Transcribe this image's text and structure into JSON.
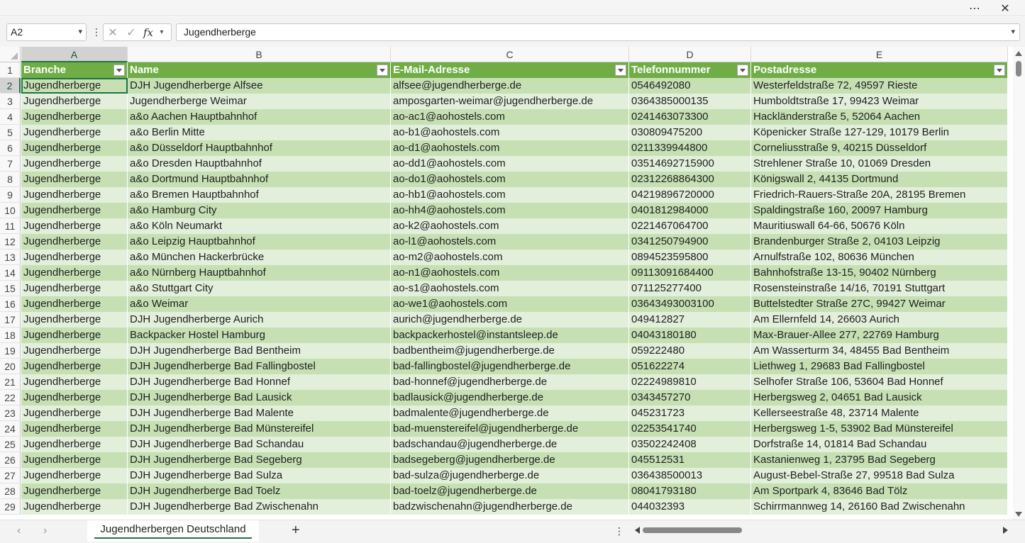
{
  "titlebar": {
    "more_icon": "ellipsis-icon",
    "close_icon": "close-icon"
  },
  "formula_bar": {
    "name_box": "A2",
    "formula_value": "Jugendherberge",
    "fx_label": "fx"
  },
  "columns": [
    {
      "letter": "A"
    },
    {
      "letter": "B"
    },
    {
      "letter": "C"
    },
    {
      "letter": "D"
    },
    {
      "letter": "E"
    }
  ],
  "header_row": {
    "number": "1",
    "cells": [
      "Branche",
      "Name",
      "E-Mail-Adresse",
      "Telefonnummer",
      "Postadresse"
    ]
  },
  "rows": [
    {
      "n": "2",
      "cells": [
        "Jugendherberge",
        "DJH Jugendherberge Alfsee",
        "alfsee@jugendherberge.de",
        "0546492080",
        "Westerfeldstraße 72, 49597 Rieste"
      ]
    },
    {
      "n": "3",
      "cells": [
        "Jugendherberge",
        "Jugendherberge Weimar",
        "amposgarten-weimar@jugendherberge.de",
        "0364385000135",
        "Humboldtstraße 17, 99423 Weimar"
      ]
    },
    {
      "n": "4",
      "cells": [
        "Jugendherberge",
        "a&o Aachen Hauptbahnhof",
        "ao-ac1@aohostels.com",
        "0241463073300",
        "Hackländerstraße 5, 52064 Aachen"
      ]
    },
    {
      "n": "5",
      "cells": [
        "Jugendherberge",
        "a&o Berlin Mitte",
        "ao-b1@aohostels.com",
        "030809475200",
        "Köpenicker Straße 127-129, 10179 Berlin"
      ]
    },
    {
      "n": "6",
      "cells": [
        "Jugendherberge",
        "a&o Düsseldorf Hauptbahnhof",
        "ao-d1@aohostels.com",
        "0211339944800",
        "Corneliusstraße 9, 40215 Düsseldorf"
      ]
    },
    {
      "n": "7",
      "cells": [
        "Jugendherberge",
        "a&o Dresden Hauptbahnhof",
        "ao-dd1@aohostels.com",
        "03514692715900",
        "Strehlener Straße 10, 01069 Dresden"
      ]
    },
    {
      "n": "8",
      "cells": [
        "Jugendherberge",
        "a&o Dortmund Hauptbahnhof",
        "ao-do1@aohostels.com",
        "02312268864300",
        "Königswall 2, 44135 Dortmund"
      ]
    },
    {
      "n": "9",
      "cells": [
        "Jugendherberge",
        "a&o Bremen Hauptbahnhof",
        "ao-hb1@aohostels.com",
        "04219896720000",
        "Friedrich-Rauers-Straße 20A, 28195 Bremen"
      ]
    },
    {
      "n": "10",
      "cells": [
        "Jugendherberge",
        "a&o Hamburg City",
        "ao-hh4@aohostels.com",
        "0401812984000",
        "Spaldingstraße 160, 20097 Hamburg"
      ]
    },
    {
      "n": "11",
      "cells": [
        "Jugendherberge",
        "a&o Köln Neumarkt",
        "ao-k2@aohostels.com",
        "0221467064700",
        "Mauritiuswall 64-66, 50676 Köln"
      ]
    },
    {
      "n": "12",
      "cells": [
        "Jugendherberge",
        "a&o Leipzig Hauptbahnhof",
        "ao-l1@aohostels.com",
        "0341250794900",
        "Brandenburger Straße 2, 04103 Leipzig"
      ]
    },
    {
      "n": "13",
      "cells": [
        "Jugendherberge",
        "a&o München Hackerbrücke",
        "ao-m2@aohostels.com",
        "0894523595800",
        "Arnulfstraße 102, 80636 München"
      ]
    },
    {
      "n": "14",
      "cells": [
        "Jugendherberge",
        "a&o Nürnberg Hauptbahnhof",
        "ao-n1@aohostels.com",
        "09113091684400",
        "Bahnhofstraße 13-15, 90402 Nürnberg"
      ]
    },
    {
      "n": "15",
      "cells": [
        "Jugendherberge",
        "a&o Stuttgart City",
        "ao-s1@aohostels.com",
        "071125277400",
        "Rosensteinstraße 14/16, 70191 Stuttgart"
      ]
    },
    {
      "n": "16",
      "cells": [
        "Jugendherberge",
        "a&o Weimar",
        "ao-we1@aohostels.com",
        "03643493003100",
        "Buttelstedter Straße 27C, 99427 Weimar"
      ]
    },
    {
      "n": "17",
      "cells": [
        "Jugendherberge",
        "DJH Jugendherberge Aurich",
        "aurich@jugendherberge.de",
        "049412827",
        "Am Ellernfeld 14, 26603 Aurich"
      ]
    },
    {
      "n": "18",
      "cells": [
        "Jugendherberge",
        "Backpacker Hostel Hamburg",
        "backpackerhostel@instantsleep.de",
        "04043180180",
        "Max-Brauer-Allee 277, 22769 Hamburg"
      ]
    },
    {
      "n": "19",
      "cells": [
        "Jugendherberge",
        "DJH Jugendherberge Bad Bentheim",
        "badbentheim@jugendherberge.de",
        "059222480",
        "Am Wasserturm 34, 48455 Bad Bentheim"
      ]
    },
    {
      "n": "20",
      "cells": [
        "Jugendherberge",
        "DJH Jugendherberge Bad Fallingbostel",
        "bad-fallingbostel@jugendherberge.de",
        "051622274",
        "Liethweg 1, 29683 Bad Fallingbostel"
      ]
    },
    {
      "n": "21",
      "cells": [
        "Jugendherberge",
        "DJH Jugendherberge Bad Honnef",
        "bad-honnef@jugendherberge.de",
        "02224989810",
        "Selhofer Straße 106, 53604 Bad Honnef"
      ]
    },
    {
      "n": "22",
      "cells": [
        "Jugendherberge",
        "DJH Jugendherberge Bad Lausick",
        "badlausick@jugendherberge.de",
        "0343457270",
        "Herbergsweg 2, 04651 Bad Lausick"
      ]
    },
    {
      "n": "23",
      "cells": [
        "Jugendherberge",
        "DJH Jugendherberge Bad Malente",
        "badmalente@jugendherberge.de",
        "045231723",
        "Kellerseestraße 48, 23714 Malente"
      ]
    },
    {
      "n": "24",
      "cells": [
        "Jugendherberge",
        "DJH Jugendherberge Bad Münstereifel",
        "bad-muenstereifel@jugendherberge.de",
        "02253541740",
        "Herbergsweg 1-5, 53902 Bad Münstereifel"
      ]
    },
    {
      "n": "25",
      "cells": [
        "Jugendherberge",
        "DJH Jugendherberge Bad Schandau",
        "badschandau@jugendherberge.de",
        "03502242408",
        "Dorfstraße 14, 01814 Bad Schandau"
      ]
    },
    {
      "n": "26",
      "cells": [
        "Jugendherberge",
        "DJH Jugendherberge Bad Segeberg",
        "badsegeberg@jugendherberge.de",
        "045512531",
        "Kastanienweg 1, 23795 Bad Segeberg"
      ]
    },
    {
      "n": "27",
      "cells": [
        "Jugendherberge",
        "DJH Jugendherberge Bad Sulza",
        "bad-sulza@jugendherberge.de",
        "036438500013",
        "August-Bebel-Straße 27, 99518 Bad Sulza"
      ]
    },
    {
      "n": "28",
      "cells": [
        "Jugendherberge",
        "DJH Jugendherberge Bad Toelz",
        "bad-toelz@jugendherberge.de",
        "08041793180",
        "Am Sportpark 4, 83646 Bad Tölz"
      ]
    },
    {
      "n": "29",
      "cells": [
        "Jugendherberge",
        "DJH Jugendherberge Bad Zwischenahn",
        "badzwischenahn@jugendherberge.de",
        "044032393",
        "Schirrmannweg 14, 26160 Bad Zwischenahn"
      ]
    }
  ],
  "sheet_tabs": {
    "active": "Jugendherbergen Deutschland",
    "add_icon": "plus-icon"
  },
  "colors": {
    "header_green": "#70ad47",
    "band_dark": "#c6e0b4",
    "band_light": "#e2efda",
    "selection": "#217346"
  }
}
